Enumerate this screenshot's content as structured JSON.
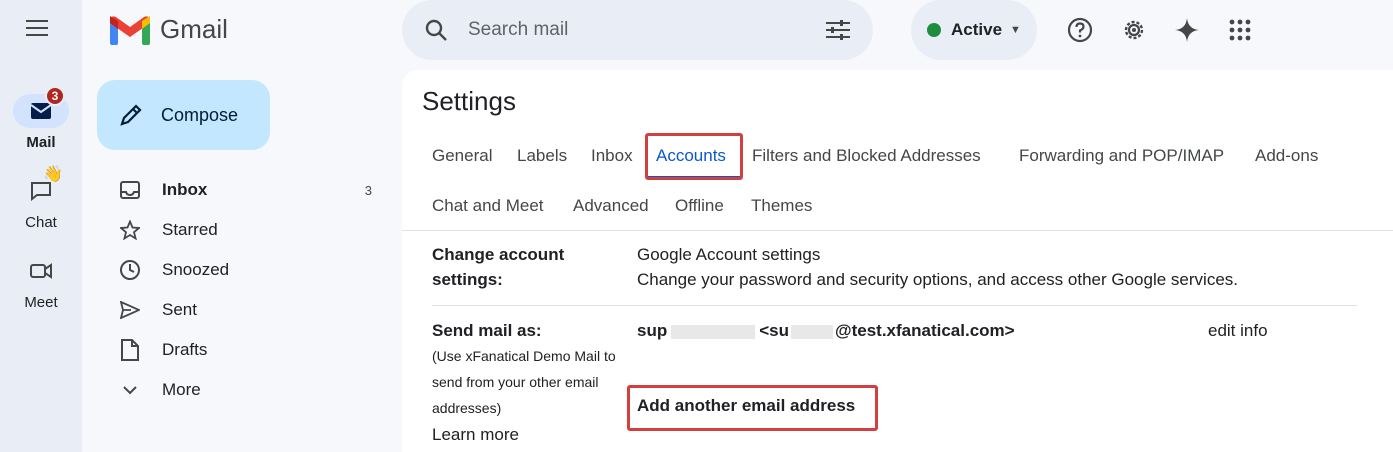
{
  "brand": {
    "name": "Gmail"
  },
  "rail": {
    "items": [
      {
        "label": "Mail",
        "badge": "3",
        "active": true
      },
      {
        "label": "Chat"
      },
      {
        "label": "Meet"
      }
    ]
  },
  "header": {
    "search_placeholder": "Search mail",
    "status_label": "Active"
  },
  "nav": {
    "compose_label": "Compose",
    "items": [
      {
        "label": "Inbox",
        "count": "3"
      },
      {
        "label": "Starred"
      },
      {
        "label": "Snoozed"
      },
      {
        "label": "Sent"
      },
      {
        "label": "Drafts"
      },
      {
        "label": "More"
      }
    ]
  },
  "settings": {
    "title": "Settings",
    "tabs": [
      "General",
      "Labels",
      "Inbox",
      "Accounts",
      "Filters and Blocked Addresses",
      "Forwarding and POP/IMAP",
      "Add-ons",
      "Chat and Meet",
      "Advanced",
      "Offline",
      "Themes"
    ],
    "active_tab": "Accounts",
    "change_account": {
      "label_line1": "Change account",
      "label_line2": "settings:",
      "link": "Google Account settings",
      "description": "Change your password and security options, and access other Google services."
    },
    "send_mail_as": {
      "label": "Send mail as:",
      "note_line1": "(Use xFanatical Demo Mail to",
      "note_line2": "send from your other email",
      "note_line3": "addresses)",
      "learn_more": "Learn more",
      "address_prefix": "sup",
      "address_mid": "<su",
      "address_suffix": "@test.xfanatical.com>",
      "edit_info": "edit info",
      "add_another": "Add another email address"
    }
  },
  "colors": {
    "accent": "#0b57d0",
    "highlight": "#d23f3f",
    "compose_bg": "#c2e7ff",
    "status_green": "#1e8e3e"
  }
}
